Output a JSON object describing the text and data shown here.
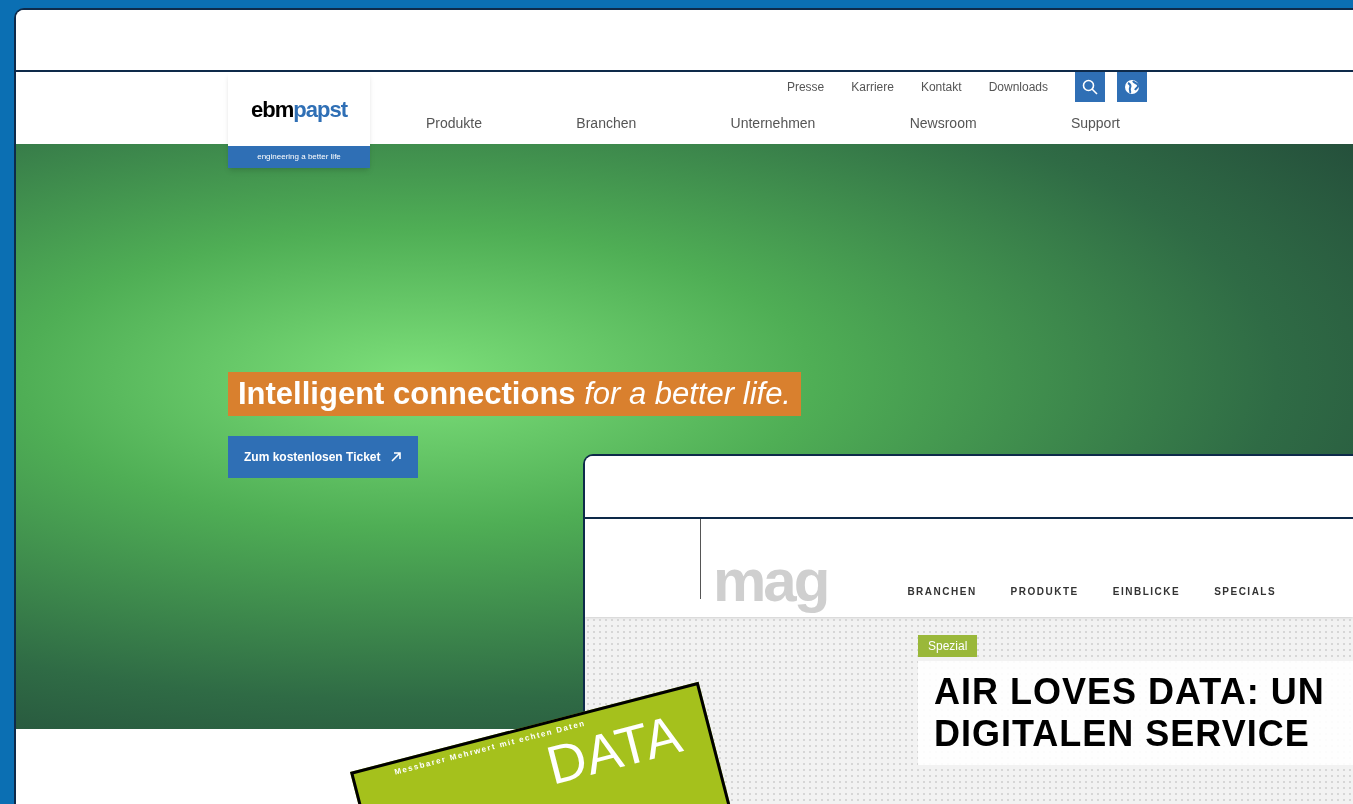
{
  "site": {
    "logo": {
      "first": "ebm",
      "second": "papst",
      "tagline": "engineering a better life"
    },
    "top_links": [
      "Presse",
      "Karriere",
      "Kontakt",
      "Downloads"
    ],
    "nav": [
      "Produkte",
      "Branchen",
      "Unternehmen",
      "Newsroom",
      "Support"
    ],
    "hero": {
      "headline": "**Intelligent connections** *for a better life.*",
      "button": "Zum kostenlosen Ticket"
    }
  },
  "card": {
    "tagline": "Messbarer Mehrwert mit echten Daten",
    "title": "DATA"
  },
  "mag": {
    "logo": "mag",
    "nav": [
      "BRANCHEN",
      "PRODUKTE",
      "EINBLICKE",
      "SPECIALS"
    ],
    "tag": "Spezial",
    "headline_lines": [
      "AIR LOVES DATA: UN",
      "DIGITALEN SERVICE"
    ]
  }
}
